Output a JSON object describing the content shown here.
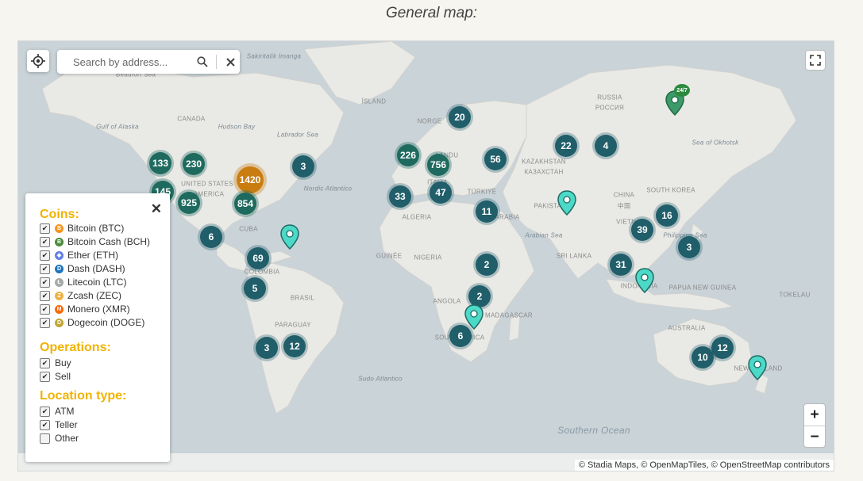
{
  "page": {
    "title": "General map:"
  },
  "search": {
    "placeholder": "Search by address..."
  },
  "zoom": {
    "in": "+",
    "out": "−"
  },
  "attribution": "© Stadia Maps, © OpenMapTiles, © OpenStreetMap contributors",
  "colors": {
    "cluster": "#1f6a5e",
    "cluster_large": "#c97d10",
    "pin": "#4dd9c8",
    "heading": "#f1b300"
  },
  "map_labels": [
    "Beaufort Sea",
    "Gulf of Alaska",
    "Hudson Bay",
    "Labrador Sea",
    "CANADA",
    "UNITED STATES",
    "AMERICA",
    "Nordic Atlantico",
    "CUBA",
    "COLOMBIA",
    "BRASIL",
    "PARAGUAY",
    "ÍSLAND",
    "NORGE",
    "LANDU",
    "ITALIA",
    "TÜRKIYE",
    "ALGERIA",
    "ARABIA",
    "GUINÉE",
    "NIGERIA",
    "ANGOLA",
    "MADAGASCAR",
    "SOUTH AFRICA",
    "RUSSIA",
    "РОССИЯ",
    "KAZAKHSTAN",
    "КАЗАХСТАН",
    "PAKISTAN",
    "CHINA",
    "中国",
    "SOUTH KOREA",
    "VIETNAM",
    "SRI LANKA",
    "INDONESIA",
    "PAPUA NEW GUINEA",
    "AUSTRALIA",
    "NEW ZEALAND",
    "TOKELAU",
    "Sea of Okhotsk",
    "Arabian Sea",
    "Philippine Sea",
    "Sakiritalik Imanga",
    "Sudo Atlantico",
    "Southern Ocean"
  ],
  "clusters": [
    {
      "count": "133"
    },
    {
      "count": "230"
    },
    {
      "count": "145"
    },
    {
      "count": "925"
    },
    {
      "count": "1420"
    },
    {
      "count": "854"
    },
    {
      "count": "3"
    },
    {
      "count": "6"
    },
    {
      "count": "69"
    },
    {
      "count": "5"
    },
    {
      "count": "3"
    },
    {
      "count": "12"
    },
    {
      "count": "20"
    },
    {
      "count": "226"
    },
    {
      "count": "756"
    },
    {
      "count": "56"
    },
    {
      "count": "33"
    },
    {
      "count": "47"
    },
    {
      "count": "11"
    },
    {
      "count": "2"
    },
    {
      "count": "2"
    },
    {
      "count": "6"
    },
    {
      "count": "22"
    },
    {
      "count": "4"
    },
    {
      "count": "16"
    },
    {
      "count": "39"
    },
    {
      "count": "31"
    },
    {
      "count": "3"
    },
    {
      "count": "10"
    },
    {
      "count": "12"
    }
  ],
  "pins": [
    {
      "badge": ""
    },
    {
      "badge": ""
    },
    {
      "badge": ""
    },
    {
      "badge": ""
    },
    {
      "badge": ""
    },
    {
      "badge": "24/7"
    }
  ],
  "legend": {
    "coins_heading": "Coins:",
    "coins": [
      {
        "label": "Bitcoin (BTC)",
        "color": "#f7931a",
        "glyph": "B",
        "checked": true
      },
      {
        "label": "Bitcoin Cash (BCH)",
        "color": "#4b8b3b",
        "glyph": "B",
        "checked": true
      },
      {
        "label": "Ether (ETH)",
        "color": "#627eea",
        "glyph": "◆",
        "checked": true
      },
      {
        "label": "Dash (DASH)",
        "color": "#1c75bc",
        "glyph": "D",
        "checked": true
      },
      {
        "label": "Litecoin (LTC)",
        "color": "#a6a9aa",
        "glyph": "Ł",
        "checked": true
      },
      {
        "label": "Zcash (ZEC)",
        "color": "#ecb244",
        "glyph": "Z",
        "checked": true
      },
      {
        "label": "Monero (XMR)",
        "color": "#ff6600",
        "glyph": "M",
        "checked": true
      },
      {
        "label": "Dogecoin (DOGE)",
        "color": "#c2a633",
        "glyph": "D",
        "checked": true
      }
    ],
    "operations_heading": "Operations:",
    "operations": [
      {
        "label": "Buy",
        "checked": true
      },
      {
        "label": "Sell",
        "checked": true
      }
    ],
    "location_heading": "Location type:",
    "locations": [
      {
        "label": "ATM",
        "checked": true
      },
      {
        "label": "Teller",
        "checked": true
      },
      {
        "label": "Other",
        "checked": false
      }
    ]
  }
}
